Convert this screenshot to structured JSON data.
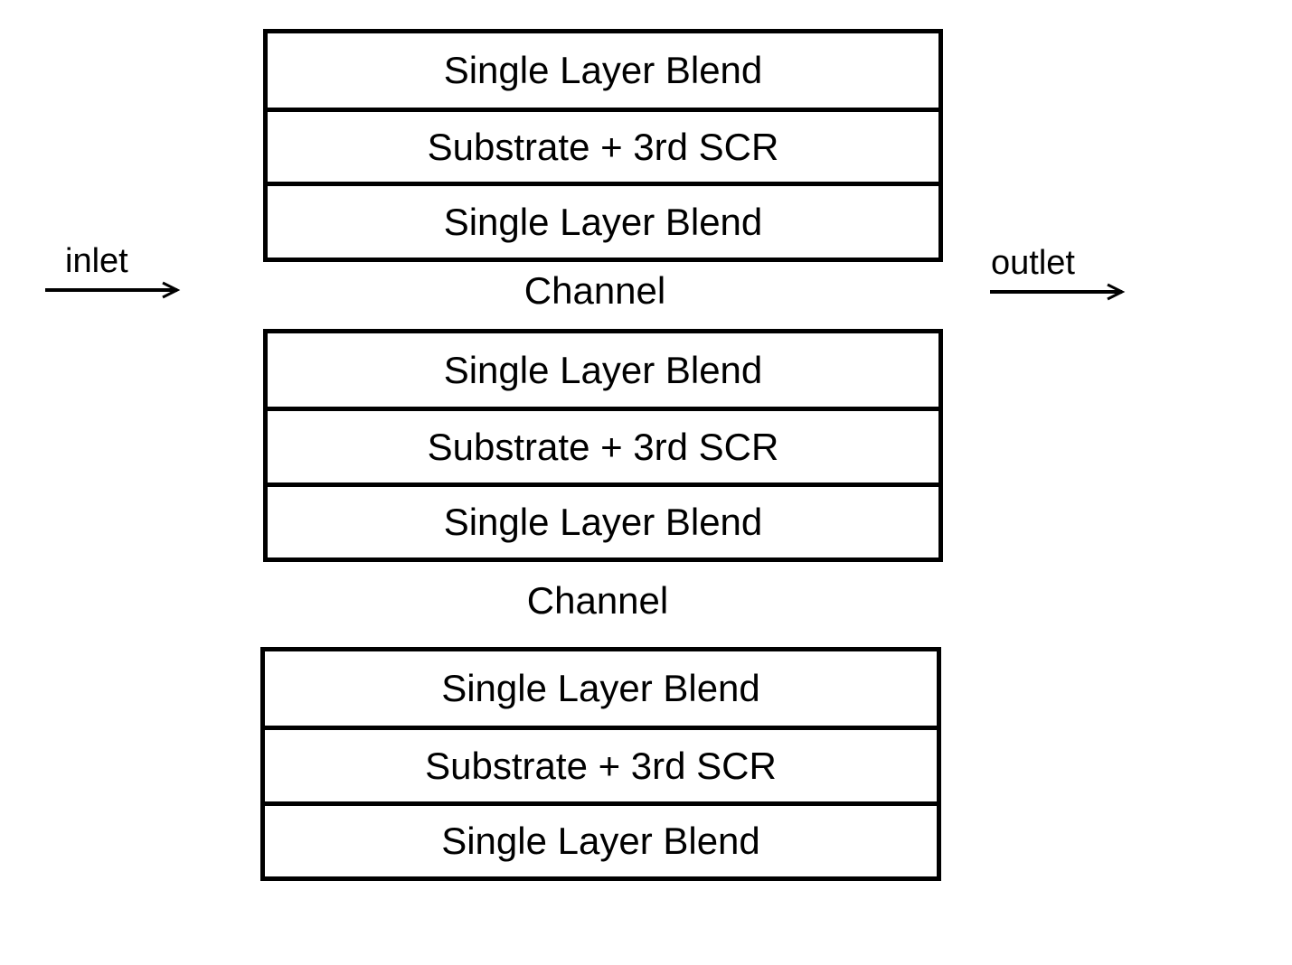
{
  "diagram": {
    "inlet_label": "inlet",
    "outlet_label": "outlet",
    "channel_label": "Channel",
    "stacks": [
      {
        "layers": [
          "Single Layer Blend",
          "Substrate + 3rd SCR",
          "Single Layer Blend"
        ]
      },
      {
        "layers": [
          "Single Layer Blend",
          "Substrate + 3rd SCR",
          "Single Layer Blend"
        ]
      },
      {
        "layers": [
          "Single Layer Blend",
          "Substrate + 3rd SCR",
          "Single Layer Blend"
        ]
      }
    ],
    "channels": [
      "Channel",
      "Channel"
    ]
  }
}
